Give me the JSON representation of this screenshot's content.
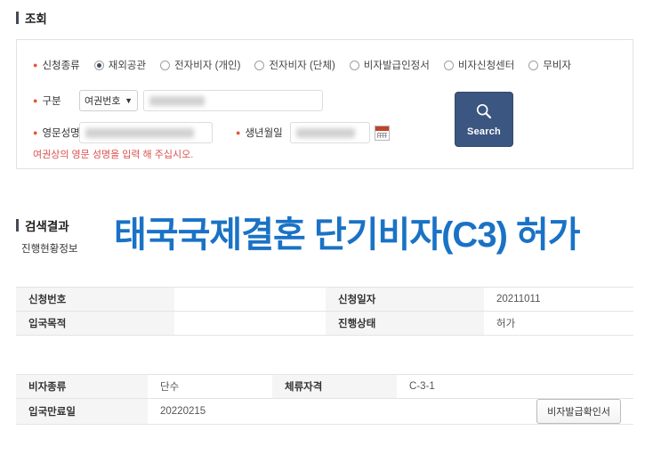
{
  "search_section": {
    "heading": "조회",
    "application_type": {
      "label": "신청종류",
      "options": [
        {
          "label": "재외공관",
          "selected": true
        },
        {
          "label": "전자비자 (개인)",
          "selected": false
        },
        {
          "label": "전자비자 (단체)",
          "selected": false
        },
        {
          "label": "비자발급인정서",
          "selected": false
        },
        {
          "label": "비자신청센터",
          "selected": false
        },
        {
          "label": "무비자",
          "selected": false
        }
      ]
    },
    "gubun": {
      "label": "구분",
      "select_value": "여권번호",
      "passport_value": "",
      "passport_redacted": true
    },
    "english_name": {
      "label": "영문성명",
      "value": "",
      "redacted": true
    },
    "birth_date": {
      "label": "생년월일",
      "value": "",
      "redacted": true,
      "calendar_icon": "calendar-icon"
    },
    "helper_text": "여권상의 영문 성명을 입력 해 주십시오.",
    "search_button": {
      "label": "Search",
      "icon": "search-icon"
    }
  },
  "result_section": {
    "heading": "검색결과",
    "subheading": "진행현황정보",
    "overlay_title": "태국국제결혼 단기비자(C3) 허가",
    "status_table": [
      {
        "label1": "신청번호",
        "value1": "",
        "label2": "신청일자",
        "value2": "20211011"
      },
      {
        "label1": "입국목적",
        "value1": "",
        "label2": "진행상태",
        "value2": "허가"
      }
    ],
    "visa_table": {
      "row1": {
        "label1": "비자종류",
        "value1": "단수",
        "label2": "체류자격",
        "value2": "C-3-1"
      },
      "row2": {
        "label1": "입국만료일",
        "value1": "20220215",
        "button_label": "비자발급확인서"
      }
    }
  },
  "colors": {
    "accent_blue": "#1a72c6",
    "search_button_bg": "#3b5680",
    "required_dot": "#e8543f",
    "helper_red": "#d9534f",
    "label_cell_bg": "#f5f5f5"
  }
}
